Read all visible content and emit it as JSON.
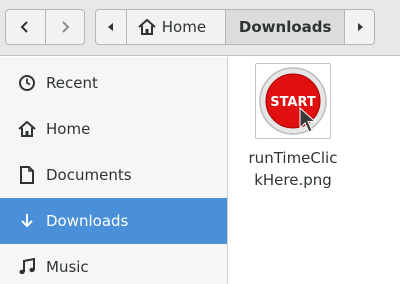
{
  "colors": {
    "accent": "#4a90d9",
    "sidebar_bg": "#f6f6f5",
    "header_bg": "#e8e8e7"
  },
  "header": {
    "back_icon": "chevron-left-icon",
    "forward_icon": "chevron-right-icon",
    "path": [
      {
        "label": "Home",
        "icon": "home-icon"
      },
      {
        "label": "Downloads",
        "current": true
      }
    ]
  },
  "sidebar": {
    "items": [
      {
        "label": "Recent",
        "icon": "clock-icon"
      },
      {
        "label": "Home",
        "icon": "home-icon"
      },
      {
        "label": "Documents",
        "icon": "document-icon"
      },
      {
        "label": "Downloads",
        "icon": "download-icon",
        "active": true
      },
      {
        "label": "Music",
        "icon": "music-icon"
      }
    ]
  },
  "files": [
    {
      "name_line1": "runTimeClic",
      "name_line2": "kHere.png",
      "thumb_text": "START"
    }
  ]
}
